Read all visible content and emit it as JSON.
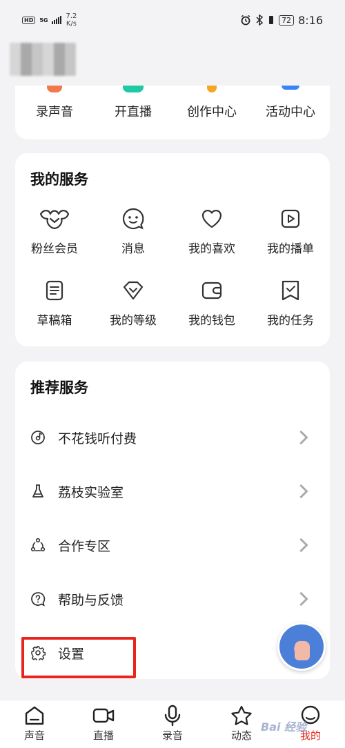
{
  "status_bar": {
    "hd": "HD",
    "network": "5G",
    "speed_value": "7.2",
    "speed_unit": "K/s",
    "battery": "72",
    "time": "8:16"
  },
  "shortcuts": [
    {
      "label": "录声音",
      "icon": "record-icon",
      "color": "#f07a4c"
    },
    {
      "label": "开直播",
      "icon": "live-icon",
      "color": "#1fc9a6"
    },
    {
      "label": "创作中心",
      "icon": "create-icon",
      "color": "#f5a623"
    },
    {
      "label": "活动中心",
      "icon": "activity-icon",
      "color": "#3b82f6"
    }
  ],
  "my_services": {
    "title": "我的服务",
    "items": [
      {
        "label": "粉丝会员",
        "icon": "fan-member-icon"
      },
      {
        "label": "消息",
        "icon": "message-icon"
      },
      {
        "label": "我的喜欢",
        "icon": "heart-icon"
      },
      {
        "label": "我的播单",
        "icon": "playlist-icon"
      },
      {
        "label": "草稿箱",
        "icon": "drafts-icon"
      },
      {
        "label": "我的等级",
        "icon": "level-icon"
      },
      {
        "label": "我的钱包",
        "icon": "wallet-icon"
      },
      {
        "label": "我的任务",
        "icon": "task-icon"
      }
    ]
  },
  "recommended": {
    "title": "推荐服务",
    "items": [
      {
        "label": "不花钱听付费",
        "icon": "music-disc-icon"
      },
      {
        "label": "荔枝实验室",
        "icon": "flask-icon"
      },
      {
        "label": "合作专区",
        "icon": "cooperation-icon"
      },
      {
        "label": "帮助与反馈",
        "icon": "help-icon"
      },
      {
        "label": "设置",
        "icon": "gear-icon"
      }
    ]
  },
  "tab_bar": {
    "tabs": [
      {
        "label": "声音",
        "icon": "home-icon"
      },
      {
        "label": "直播",
        "icon": "video-icon"
      },
      {
        "label": "录音",
        "icon": "microphone-icon"
      },
      {
        "label": "动态",
        "icon": "star-icon"
      },
      {
        "label": "我的",
        "icon": "profile-icon",
        "active": true
      }
    ]
  },
  "colors": {
    "accent": "#e8241c",
    "highlight_box": "#e8241c"
  }
}
